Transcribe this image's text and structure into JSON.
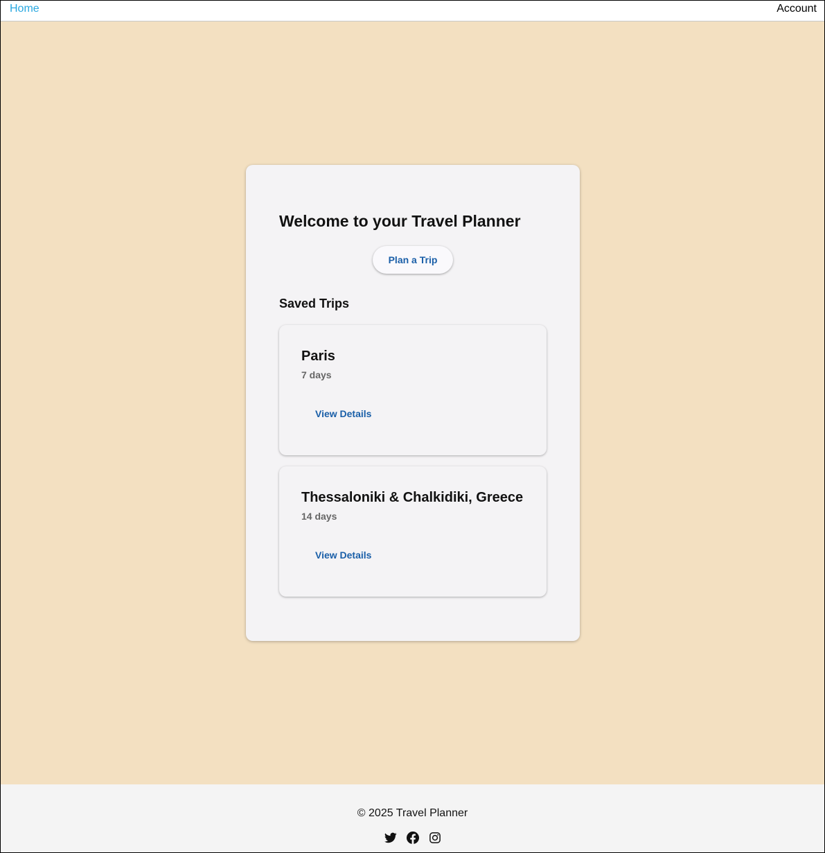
{
  "nav": {
    "home_label": "Home",
    "account_label": "Account"
  },
  "panel": {
    "title": "Welcome to your Travel Planner",
    "plan_button_label": "Plan a Trip",
    "saved_heading": "Saved Trips"
  },
  "trips": [
    {
      "name": "Paris",
      "duration": "7 days",
      "action_label": "View Details"
    },
    {
      "name": "Thessaloniki & Chalkidiki, Greece",
      "duration": "14 days",
      "action_label": "View Details"
    }
  ],
  "footer": {
    "copyright": "© 2025 Travel Planner",
    "social_icons": [
      "twitter-icon",
      "facebook-icon",
      "instagram-icon"
    ]
  },
  "colors": {
    "accent": "#1a5fa8",
    "nav_link": "#29a8e0",
    "page_background": "#f3e0c1",
    "panel_background": "#f4f3f5",
    "footer_background": "#f4f4f4"
  }
}
